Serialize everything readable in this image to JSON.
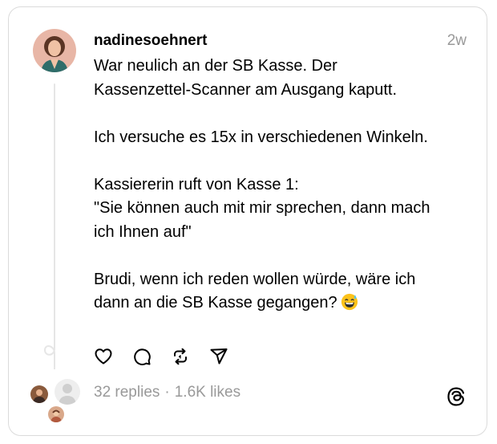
{
  "post": {
    "username": "nadinesoehnert",
    "timestamp": "2w",
    "paragraphs": [
      "War neulich an der SB Kasse. Der\nKassenzettel-Scanner am Ausgang kaputt.",
      "Ich versuche es 15x in verschiedenen Winkeln.",
      "Kassiererin ruft von Kasse 1:\n\"Sie können auch mit mir sprechen, dann mach\nich Ihnen auf\"",
      "Brudi, wenn ich reden wollen würde, wäre ich\ndann an die SB Kasse gegangen?"
    ],
    "emoji": "grinning-face-with-sweat-emoji"
  },
  "stats": {
    "replies": "32 replies",
    "separator": "·",
    "likes": "1.6K likes"
  },
  "actions": {
    "like_icon": "heart-icon",
    "comment_icon": "comment-icon",
    "repost_icon": "repost-icon",
    "share_icon": "share-icon"
  },
  "brand": {
    "logo_icon": "threads-logo-icon"
  },
  "colors": {
    "text": "#000000",
    "muted": "#999999",
    "border": "#dbdbdb",
    "thread_line": "#e6e6e6"
  }
}
